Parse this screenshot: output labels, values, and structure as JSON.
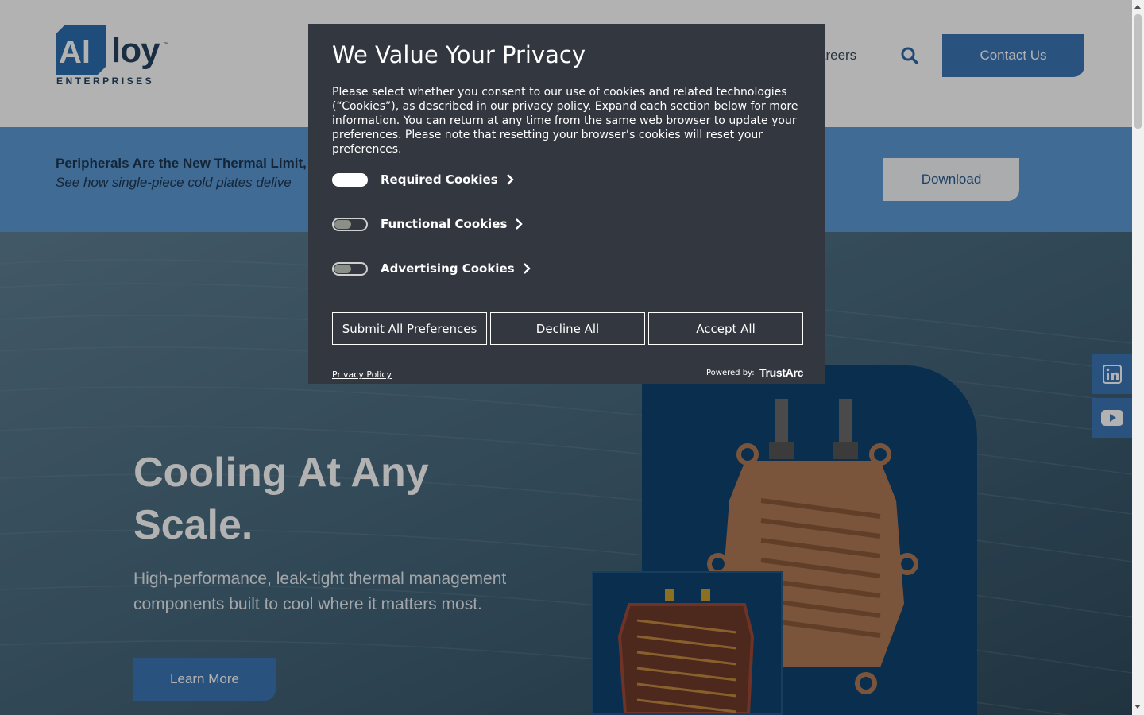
{
  "header": {
    "logo": {
      "wordmark": "Al",
      "wordmark_rest": "loy",
      "tm": "™",
      "subtitle": "ENTERPRISES"
    },
    "nav_partial": "areers",
    "search_icon": "search-icon",
    "contact_label": "Contact Us"
  },
  "banner": {
    "title": "Peripherals Are the New Thermal Limit,",
    "subtitle": "See how single-piece cold plates delive",
    "download_label": "Download"
  },
  "hero": {
    "title": "Cooling At Any Scale.",
    "subtitle": "High-performance, leak-tight thermal management components built to cool where it matters most.",
    "learn_more_label": "Learn More"
  },
  "social": {
    "linkedin_icon": "linkedin-icon",
    "youtube_icon": "youtube-icon"
  },
  "consent": {
    "title": "We Value Your Privacy",
    "body": "Please select whether you consent to our use of cookies and related technologies (“Cookies”), as described in our privacy policy. Expand each section below for more information. You can return at any time from the same web browser to update your preferences. Please note that resetting your browser’s cookies will reset your preferences.",
    "categories": [
      {
        "label": "Required Cookies",
        "enabled": true
      },
      {
        "label": "Functional Cookies",
        "enabled": false
      },
      {
        "label": "Advertising Cookies",
        "enabled": false
      }
    ],
    "buttons": {
      "submit": "Submit All Preferences",
      "decline": "Decline All",
      "accept": "Accept All"
    },
    "privacy_link": "Privacy Policy",
    "powered_by": "Powered by:",
    "brand": "TrustArc"
  },
  "colors": {
    "brand_blue": "#3b78b5",
    "banner_blue": "#5b9ad6",
    "dialog_bg": "#333740",
    "navy": "#25425f"
  }
}
